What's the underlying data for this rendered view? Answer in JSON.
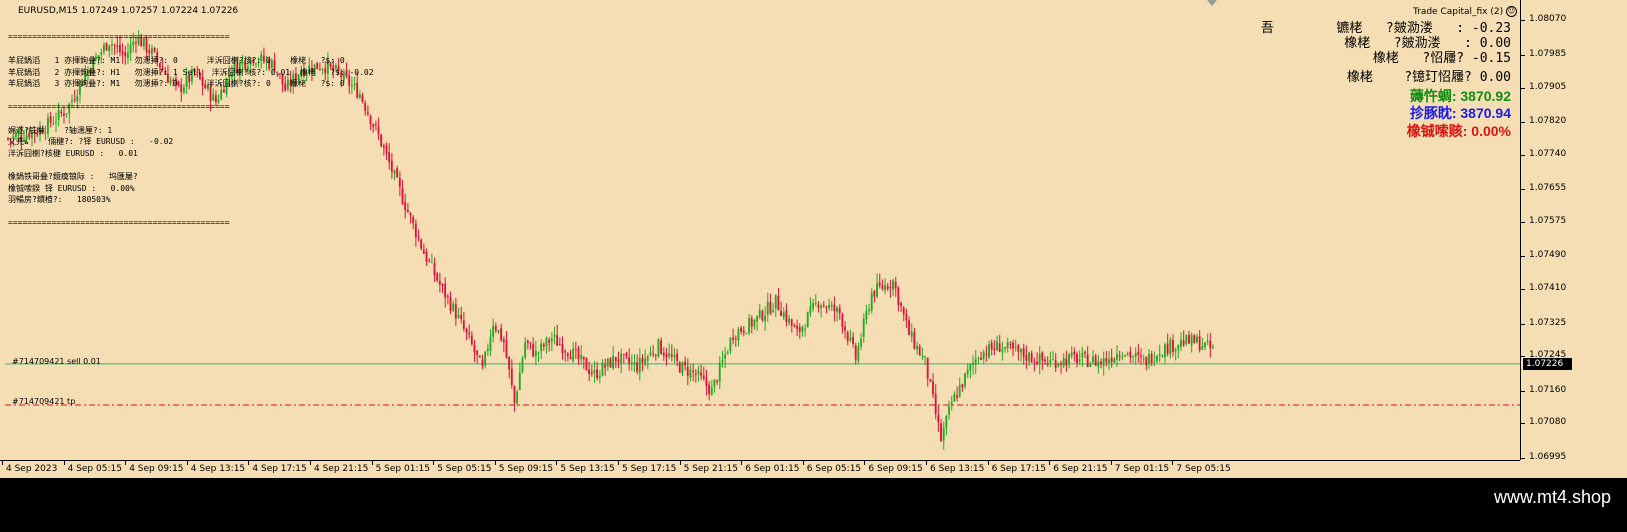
{
  "header": {
    "symbol_label": "EURUSD,M15  1.07249 1.07257 1.07224 1.07226",
    "ea_name": "Trade Capital_fix (2)",
    "ea_icon": "smiley-icon"
  },
  "info_panel": {
    "lines": [
      "==============================================",
      "",
      "羊屁鍋滔   1 亦揮鉤叠?: M1   勿漶揷?: 0      泮泝囧楋?核?: 0    橡栳   ?$: 0",
      "羊屁鍋滔   2 亦揮鉤叠?: H1   勿漶揷?: 1 Sell  泮泝囧楋?核?: 0.01  橡栳   ?$: -0.02",
      "羊屁鍋滔   3 亦揮鉤叠?: M1   勿漶揷?: 0      泮泝囧楋?核?: 0    橡栳   ?$: 0",
      "",
      "==============================================",
      "",
      "娓遂?铁举    ?轴漶厘?: 1",
      "乂尭ь    倆楗?: ?铎 EURUSD :   -0.02",
      "泮泝囧楋?核楗 EURUSD :   0.01",
      "",
      "橡鍋铁哥叠?鏡瘼锒际 :   坞匯屡?",
      "橡铖嗦鍨 铎 EURUSD :   0.00%",
      "羽暢房?鏆楂?:   180503%",
      "",
      "=============================================="
    ]
  },
  "right_panel": {
    "rows": [
      "吾        镳栳   ?皴泐溇   : -0.23",
      "橡栳   ?皴泐溇   : 0.00",
      "橡栳   ?怊屨? -0.15",
      "",
      "橡栳    ?镱玎怊屨? 0.00"
    ],
    "balance_label": "薅忤蜩:",
    "balance_value": "3870.92",
    "equity_label": "抮豚眈:",
    "equity_value": "3870.94",
    "drawdown_label": "橡铖嗦赅:",
    "drawdown_value": "0.00%",
    "colors": {
      "balance": "#138a13",
      "equity": "#1a1aee",
      "drawdown": "#e01010"
    }
  },
  "order_lines": {
    "sell_label": "#714709421 sell 0.01",
    "tp_label": "#714709421 tp",
    "sell_price": 1.07226,
    "tp_price": 1.07125,
    "sell_color": "#3cb371",
    "tp_color": "#e01010"
  },
  "price_axis": {
    "ticks": [
      "1.08070",
      "1.07985",
      "1.07905",
      "1.07820",
      "1.07740",
      "1.07655",
      "1.07575",
      "1.07490",
      "1.07410",
      "1.07325",
      "1.07245",
      "1.07160",
      "1.07080",
      "1.06995"
    ],
    "current": "1.07226"
  },
  "time_axis": {
    "ticks": [
      "4 Sep 2023",
      "4 Sep 05:15",
      "4 Sep 09:15",
      "4 Sep 13:15",
      "4 Sep 17:15",
      "4 Sep 21:15",
      "5 Sep 01:15",
      "5 Sep 05:15",
      "5 Sep 09:15",
      "5 Sep 13:15",
      "5 Sep 17:15",
      "5 Sep 21:15",
      "6 Sep 01:15",
      "6 Sep 05:15",
      "6 Sep 09:15",
      "6 Sep 13:15",
      "6 Sep 17:15",
      "6 Sep 21:15",
      "7 Sep 01:15",
      "7 Sep 05:15"
    ]
  },
  "footer": {
    "watermark": "www.mt4.shop"
  },
  "chart_data": {
    "type": "candlestick",
    "symbol": "EURUSD",
    "timeframe": "M15",
    "ylim": [
      1.0699,
      1.0812
    ],
    "bull_color": "#22aa22",
    "bear_color": "#e0103a",
    "close_path": [
      [
        0,
        1.0778
      ],
      [
        12,
        1.078
      ],
      [
        22,
        1.0785
      ],
      [
        30,
        1.0795
      ],
      [
        38,
        1.0802
      ],
      [
        44,
        1.0798
      ],
      [
        48,
        1.0803
      ],
      [
        54,
        1.0799
      ],
      [
        60,
        1.0793
      ],
      [
        64,
        1.079
      ],
      [
        70,
        1.0794
      ],
      [
        78,
        1.0787
      ],
      [
        84,
        1.0795
      ],
      [
        92,
        1.0798
      ],
      [
        100,
        1.0796
      ],
      [
        104,
        1.079
      ],
      [
        110,
        1.0795
      ],
      [
        118,
        1.0796
      ],
      [
        124,
        1.0794
      ],
      [
        132,
        1.0789
      ],
      [
        140,
        1.0777
      ],
      [
        150,
        1.076
      ],
      [
        156,
        1.075
      ],
      [
        162,
        1.0742
      ],
      [
        168,
        1.0735
      ],
      [
        174,
        1.0727
      ],
      [
        178,
        1.0721
      ],
      [
        182,
        1.0733
      ],
      [
        186,
        1.0728
      ],
      [
        190,
        1.0713
      ],
      [
        194,
        1.0728
      ],
      [
        198,
        1.0725
      ],
      [
        204,
        1.0729
      ],
      [
        212,
        1.0725
      ],
      [
        220,
        1.072
      ],
      [
        228,
        1.0724
      ],
      [
        236,
        1.0722
      ],
      [
        244,
        1.0727
      ],
      [
        252,
        1.0722
      ],
      [
        258,
        1.072
      ],
      [
        264,
        1.0716
      ],
      [
        272,
        1.073
      ],
      [
        280,
        1.0733
      ],
      [
        288,
        1.0738
      ],
      [
        296,
        1.073
      ],
      [
        304,
        1.0738
      ],
      [
        312,
        1.0735
      ],
      [
        318,
        1.0724
      ],
      [
        324,
        1.074
      ],
      [
        332,
        1.0743
      ],
      [
        338,
        1.073
      ],
      [
        344,
        1.0723
      ],
      [
        350,
        1.0704
      ],
      [
        354,
        1.0713
      ],
      [
        358,
        1.0718
      ],
      [
        364,
        1.0725
      ],
      [
        372,
        1.0727
      ],
      [
        380,
        1.0725
      ],
      [
        390,
        1.0723
      ],
      [
        400,
        1.0724
      ],
      [
        410,
        1.0723
      ],
      [
        418,
        1.0726
      ],
      [
        426,
        1.0723
      ],
      [
        432,
        1.0726
      ],
      [
        440,
        1.0728
      ],
      [
        446,
        1.0728
      ],
      [
        452,
        1.0726
      ]
    ]
  }
}
